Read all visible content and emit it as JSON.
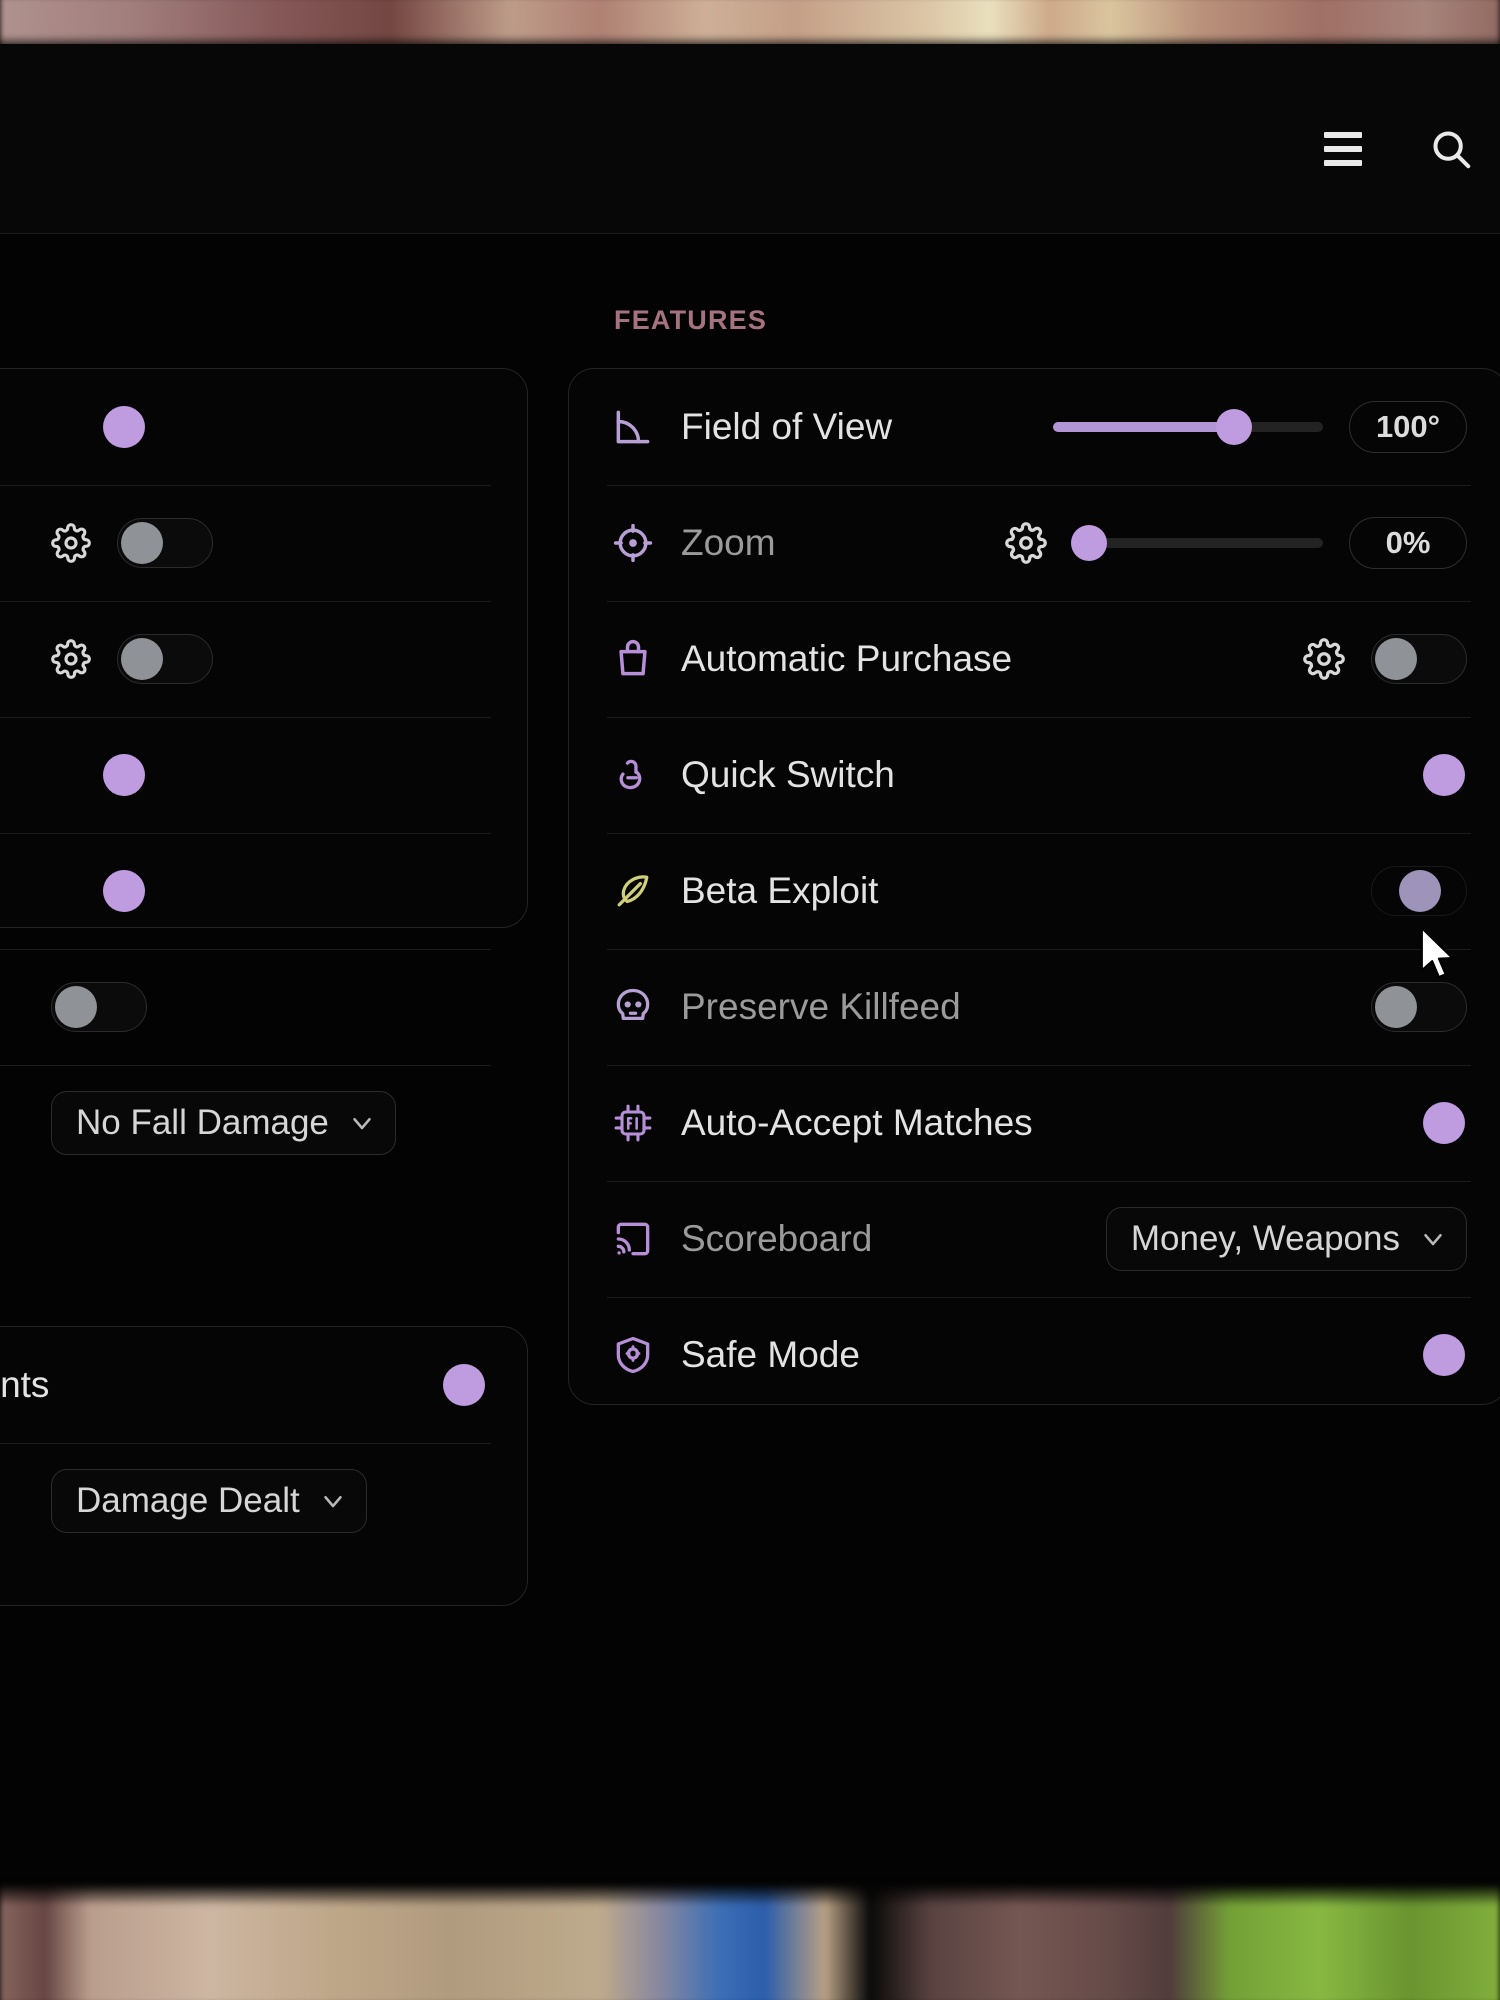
{
  "topbar": {
    "menu_icon": "hamburger-menu-icon",
    "search_icon": "search-icon"
  },
  "features_panel": {
    "section_label": "FEATURES",
    "rows": [
      {
        "label": "Field of View",
        "icon": "angle-measure-icon",
        "control": "slider",
        "slider_percent": 67,
        "value": "100°",
        "has_gear": false
      },
      {
        "label": "Zoom",
        "icon": "crosshair-icon",
        "control": "slider",
        "slider_percent": 0,
        "value": "0%",
        "has_gear": true
      },
      {
        "label": "Automatic Purchase",
        "icon": "shopping-bag-icon",
        "control": "toggle",
        "toggle_state": "off",
        "has_gear": true
      },
      {
        "label": "Quick Switch",
        "icon": "hand-swap-icon",
        "control": "toggle",
        "toggle_state": "on",
        "has_gear": false
      },
      {
        "label": "Beta Exploit",
        "icon": "feather-icon",
        "control": "toggle",
        "toggle_state": "mid",
        "has_gear": false
      },
      {
        "label": "Preserve Killfeed",
        "icon": "skull-icon",
        "control": "toggle",
        "toggle_state": "off",
        "has_gear": false
      },
      {
        "label": "Auto-Accept Matches",
        "icon": "ai-chip-icon",
        "control": "toggle",
        "toggle_state": "on",
        "has_gear": false
      },
      {
        "label": "Scoreboard",
        "icon": "cast-screen-icon",
        "control": "dropdown",
        "value": "Money, Weapons",
        "has_gear": false
      },
      {
        "label": "Safe Mode",
        "icon": "shield-icon",
        "control": "toggle",
        "toggle_state": "on",
        "has_gear": false
      }
    ]
  },
  "left_panel_top": {
    "rows": [
      {
        "control": "toggle",
        "toggle_state": "on",
        "has_gear": false
      },
      {
        "control": "toggle",
        "toggle_state": "off",
        "has_gear": true
      },
      {
        "control": "toggle",
        "toggle_state": "off",
        "has_gear": true
      },
      {
        "control": "toggle",
        "toggle_state": "on",
        "has_gear": false
      },
      {
        "control": "toggle",
        "toggle_state": "on",
        "has_gear": false
      },
      {
        "control": "toggle",
        "toggle_state": "off",
        "has_gear": false
      },
      {
        "control": "dropdown",
        "value": "No Fall Damage"
      }
    ]
  },
  "left_panel_bottom": {
    "rows": [
      {
        "label": "vents",
        "control": "toggle",
        "toggle_state": "on"
      },
      {
        "control": "dropdown",
        "value": "Damage Dealt"
      }
    ]
  },
  "colors": {
    "accent": "#bf9ce0",
    "accent_track": "#b195d4",
    "section_label": "#a4737f",
    "toggle_off_knob": "#8f9297",
    "panel_border": "#242424",
    "background": "#030303"
  }
}
